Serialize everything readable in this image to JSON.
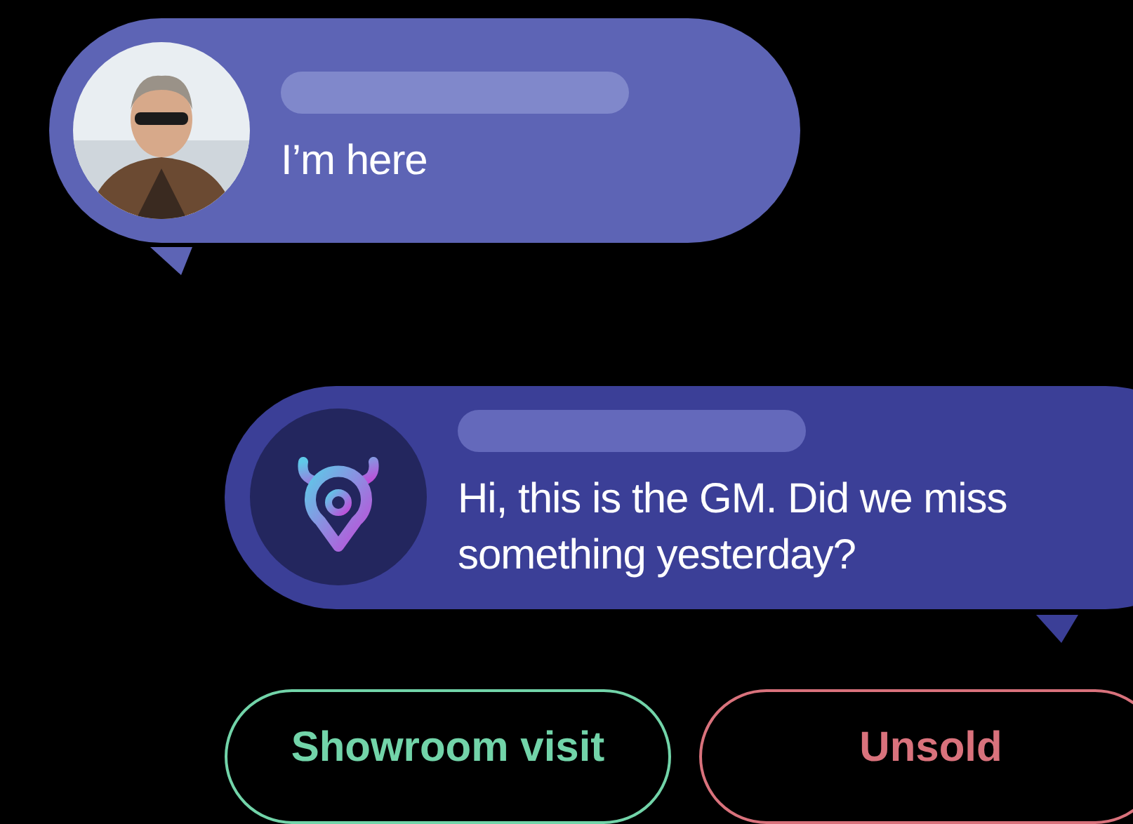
{
  "messages": [
    {
      "kind": "person",
      "text": "I’m here"
    },
    {
      "kind": "logo",
      "text": "Hi, this is the GM. Did we miss something yesterday?"
    }
  ],
  "buttons": [
    {
      "label": "Showroom visit",
      "color": "#72d4a9"
    },
    {
      "label": "Unsold",
      "color": "#d9727c"
    }
  ]
}
